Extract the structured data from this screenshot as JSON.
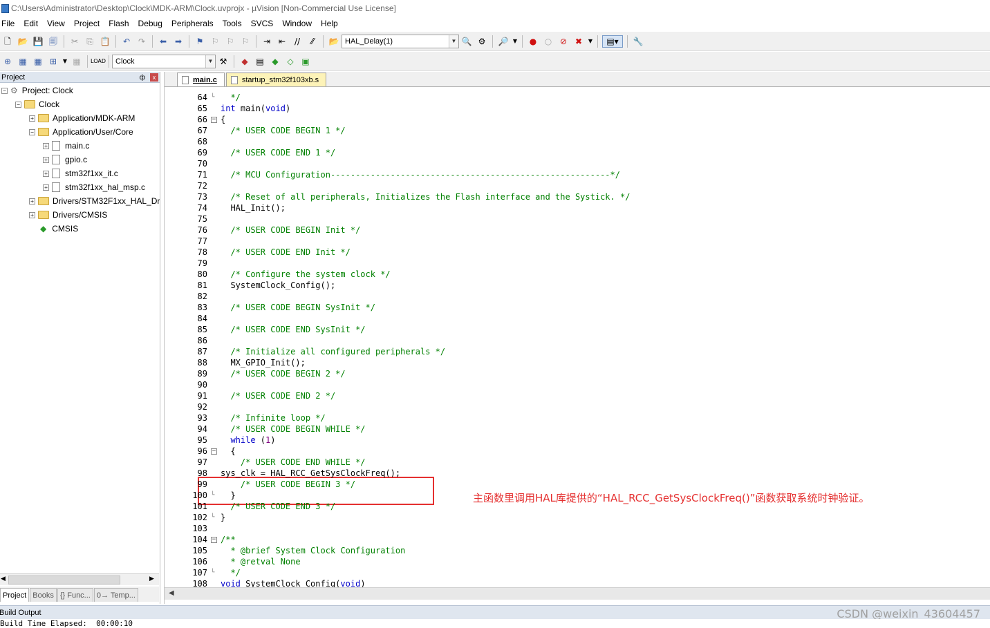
{
  "window": {
    "title": "C:\\Users\\Administrator\\Desktop\\Clock\\MDK-ARM\\Clock.uvprojx - µVision  [Non-Commercial Use License]"
  },
  "menu": [
    "File",
    "Edit",
    "View",
    "Project",
    "Flash",
    "Debug",
    "Peripherals",
    "Tools",
    "SVCS",
    "Window",
    "Help"
  ],
  "toolbar": {
    "function_combo": "HAL_Delay(1)",
    "target_combo": "Clock"
  },
  "project_panel": {
    "title": "Project",
    "pin": "ф",
    "close": "x",
    "tree": [
      {
        "label": "Project: Clock",
        "exp": "−"
      },
      {
        "label": "Clock",
        "exp": "−"
      },
      {
        "label": "Application/MDK-ARM",
        "exp": "+"
      },
      {
        "label": "Application/User/Core",
        "exp": "−"
      },
      {
        "label": "main.c",
        "exp": "+"
      },
      {
        "label": "gpio.c",
        "exp": "+"
      },
      {
        "label": "stm32f1xx_it.c",
        "exp": "+"
      },
      {
        "label": "stm32f1xx_hal_msp.c",
        "exp": "+"
      },
      {
        "label": "Drivers/STM32F1xx_HAL_Driver",
        "exp": "+"
      },
      {
        "label": "Drivers/CMSIS",
        "exp": "+"
      },
      {
        "label": "CMSIS",
        "exp": ""
      }
    ],
    "tabs": [
      "Project",
      "Books",
      "{} Func...",
      "0→ Temp..."
    ]
  },
  "editor": {
    "tabs": [
      "main.c",
      "startup_stm32f103xb.s"
    ],
    "lines": [
      {
        "n": "64",
        "t": "  */"
      },
      {
        "n": "65",
        "t": "int main(void)"
      },
      {
        "n": "66",
        "t": "{"
      },
      {
        "n": "67",
        "t": "  /* USER CODE BEGIN 1 */"
      },
      {
        "n": "68",
        "t": ""
      },
      {
        "n": "69",
        "t": "  /* USER CODE END 1 */"
      },
      {
        "n": "70",
        "t": ""
      },
      {
        "n": "71",
        "t": "  /* MCU Configuration--------------------------------------------------------*/"
      },
      {
        "n": "72",
        "t": ""
      },
      {
        "n": "73",
        "t": "  /* Reset of all peripherals, Initializes the Flash interface and the Systick. */"
      },
      {
        "n": "74",
        "t": "  HAL_Init();"
      },
      {
        "n": "75",
        "t": ""
      },
      {
        "n": "76",
        "t": "  /* USER CODE BEGIN Init */"
      },
      {
        "n": "77",
        "t": ""
      },
      {
        "n": "78",
        "t": "  /* USER CODE END Init */"
      },
      {
        "n": "79",
        "t": ""
      },
      {
        "n": "80",
        "t": "  /* Configure the system clock */"
      },
      {
        "n": "81",
        "t": "  SystemClock_Config();"
      },
      {
        "n": "82",
        "t": ""
      },
      {
        "n": "83",
        "t": "  /* USER CODE BEGIN SysInit */"
      },
      {
        "n": "84",
        "t": ""
      },
      {
        "n": "85",
        "t": "  /* USER CODE END SysInit */"
      },
      {
        "n": "86",
        "t": ""
      },
      {
        "n": "87",
        "t": "  /* Initialize all configured peripherals */"
      },
      {
        "n": "88",
        "t": "  MX_GPIO_Init();"
      },
      {
        "n": "89",
        "t": "  /* USER CODE BEGIN 2 */"
      },
      {
        "n": "90",
        "t": ""
      },
      {
        "n": "91",
        "t": "  /* USER CODE END 2 */"
      },
      {
        "n": "92",
        "t": ""
      },
      {
        "n": "93",
        "t": "  /* Infinite loop */"
      },
      {
        "n": "94",
        "t": "  /* USER CODE BEGIN WHILE */"
      },
      {
        "n": "95",
        "t": "  while (1)"
      },
      {
        "n": "96",
        "t": "  {"
      },
      {
        "n": "97",
        "t": "    /* USER CODE END WHILE */"
      },
      {
        "n": "98",
        "t": "sys_clk = HAL_RCC_GetSysClockFreq();"
      },
      {
        "n": "99",
        "t": "    /* USER CODE BEGIN 3 */"
      },
      {
        "n": "100",
        "t": "  }"
      },
      {
        "n": "101",
        "t": "  /* USER CODE END 3 */"
      },
      {
        "n": "102",
        "t": "}"
      },
      {
        "n": "103",
        "t": ""
      },
      {
        "n": "104",
        "t": "/**"
      },
      {
        "n": "105",
        "t": "  * @brief System Clock Configuration"
      },
      {
        "n": "106",
        "t": "  * @retval None"
      },
      {
        "n": "107",
        "t": "  */"
      },
      {
        "n": "108",
        "t": "void SystemClock_Config(void)"
      }
    ],
    "annotation": "主函数里调用HAL库提供的“HAL_RCC_GetSysClockFreq()”函数获取系统时钟验证。"
  },
  "build_output": {
    "title": "Build Output",
    "text": "Build Time Elapsed:  00:00:10"
  },
  "watermark": "CSDN @weixin_43604457",
  "colors": {
    "comment": "#008000",
    "keyword": "#0000c8",
    "number": "#800080",
    "highlight": "#e53030"
  }
}
